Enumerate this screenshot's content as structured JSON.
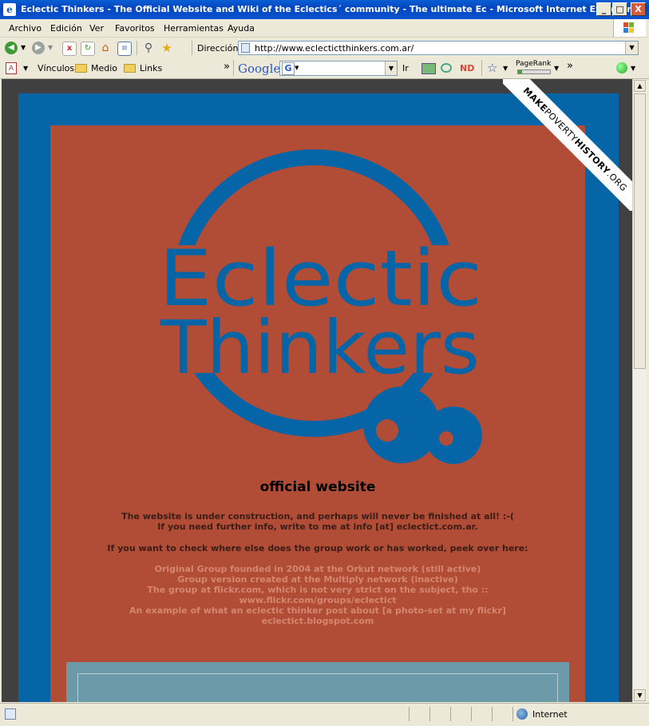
{
  "window": {
    "title": "Eclectic Thinkers - The Official Website and Wiki of the Eclectics´ community - The ultimate Ec - Microsoft Internet Explorer",
    "buttons": [
      "_",
      "□",
      "X"
    ]
  },
  "menu": [
    "Archivo",
    "Edición",
    "Ver",
    "Favoritos",
    "Herramientas",
    "Ayuda"
  ],
  "address": {
    "label": "Dirección",
    "url": "http://www.eclectictthinkers.com.ar/"
  },
  "links_bar": {
    "links_label": "Vínculos",
    "folders": [
      "Medio",
      "Links"
    ],
    "chevron": "»",
    "google_logo": "Google",
    "go_label": "Ir",
    "nd_label": "ND",
    "pagerank_label": "PageRank",
    "chevron2": "»"
  },
  "page": {
    "logo_line1": "Eclectic",
    "logo_line2": "Thinkers",
    "heading": "official website",
    "intro": [
      "The website is under construction, and perhaps will never be finished at all! :-(",
      "If you need further info, write to me at info [at] eclectict.com.ar."
    ],
    "peek": "If you want to check where else does the group work or has worked, peek over here:",
    "links": [
      "Original Group founded in 2004 at the Orkut network (still active)",
      "Group version created at the Multiply network (inactive)",
      "The group at flickr.com, which is not very strict on the subject, tho ::",
      "www.flickr.com/groups/eclectict",
      "An example of what an eclectic thinker post about [a photo-set at my flickr]",
      "eclectict.blogspot.com"
    ],
    "ribbon_parts": [
      "MAKE",
      "POVERTY",
      "HISTORY",
      ".ORG"
    ]
  },
  "status": {
    "zone": "Internet"
  },
  "colors": {
    "blue": "#0565a7",
    "rust": "#b14d37",
    "teal": "#6d9aa9"
  }
}
